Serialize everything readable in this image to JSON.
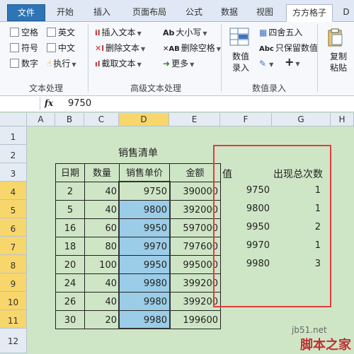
{
  "tabs": [
    "文件",
    "开始",
    "插入",
    "页面布局",
    "公式",
    "数据",
    "视图",
    "方方格子",
    "D"
  ],
  "ribbon": {
    "text_processing": {
      "checkboxes": [
        "空格",
        "英文",
        "符号",
        "中文",
        "数字"
      ],
      "execute": "执行",
      "group_label": "文本处理"
    },
    "advanced_text": {
      "insert_text": "插入文本",
      "delete_text": "删除文本",
      "truncate_text": "截取文本",
      "case": "大小写",
      "delete_spaces": "删除空格",
      "more": "更多",
      "group_label": "高级文本处理"
    },
    "numeric_entry": {
      "numeric_entry_btn": "数值\n录入",
      "round": "四舍五入",
      "keep_value": "只保留数值",
      "group_label": "数值录入"
    },
    "clipboard": {
      "copy_paste": "复制\n粘贴"
    }
  },
  "formula_bar": {
    "fx": "fx",
    "value": "9750"
  },
  "columns": [
    "A",
    "B",
    "C",
    "D",
    "E",
    "F",
    "G",
    "H"
  ],
  "rows": [
    "1",
    "2",
    "3",
    "4",
    "5",
    "6",
    "7",
    "8",
    "9",
    "10",
    "11",
    "12"
  ],
  "sheet": {
    "title": "销售清单",
    "headers": [
      "日期",
      "数量",
      "销售单价",
      "金额"
    ],
    "data": [
      [
        "2",
        "40",
        "9750",
        "390000"
      ],
      [
        "5",
        "40",
        "9800",
        "392000"
      ],
      [
        "16",
        "60",
        "9950",
        "597000"
      ],
      [
        "18",
        "80",
        "9970",
        "797600"
      ],
      [
        "20",
        "100",
        "9950",
        "995000"
      ],
      [
        "24",
        "40",
        "9980",
        "399200"
      ],
      [
        "26",
        "40",
        "9980",
        "399200"
      ],
      [
        "30",
        "20",
        "9980",
        "199600"
      ]
    ],
    "result_headers": [
      "值",
      "出现总次数"
    ],
    "results": [
      [
        "9750",
        "1"
      ],
      [
        "9800",
        "1"
      ],
      [
        "9950",
        "2"
      ],
      [
        "9970",
        "1"
      ],
      [
        "9980",
        "3"
      ]
    ]
  },
  "watermark": {
    "line1": "jb51.net",
    "line2": "脚本之家"
  },
  "colors": {
    "highlight_border": "#e23c3c",
    "selection": "#9ccde8",
    "sheet_bg": "#cfe6c6"
  }
}
